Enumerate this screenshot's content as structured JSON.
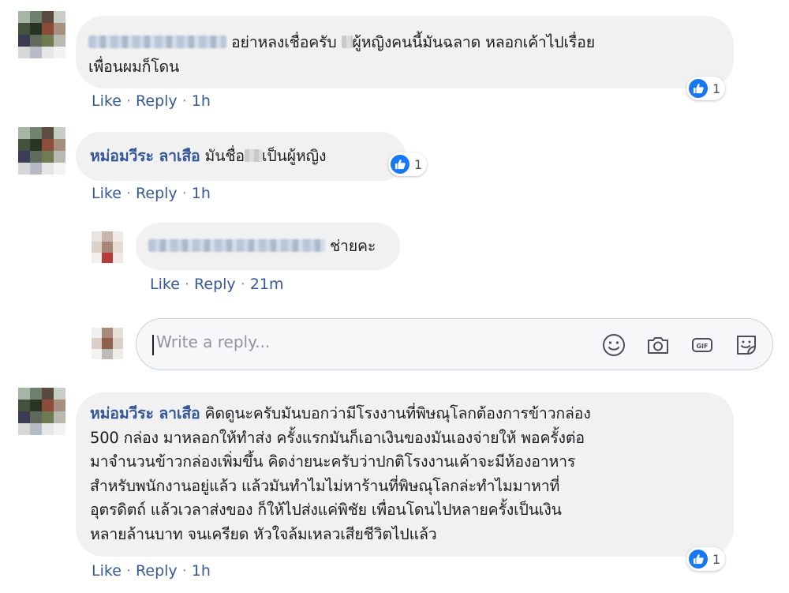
{
  "comments": [
    {
      "author": "",
      "text_line1": "อย่าหลงเชื่อครับ",
      "text_line1b": "ผู้หญิงคนนี้มันฉลาด หลอกเค้าไปเรื่อย",
      "text_line2": "เพื่อนผมก็โดน",
      "actions": {
        "like": "Like",
        "reply": "Reply",
        "time": "1h"
      },
      "reactions": {
        "count": "1"
      }
    },
    {
      "author": "หม่อมวีระ ลาเสือ",
      "text_a": "มันชื่อ",
      "text_b": "เป็นผู้หญิง",
      "actions": {
        "like": "Like",
        "reply": "Reply",
        "time": "1h"
      },
      "reactions": {
        "count": "1"
      }
    },
    {
      "author": "",
      "text": "ช่ายคะ",
      "actions": {
        "like": "Like",
        "reply": "Reply",
        "time": "21m"
      }
    },
    {
      "author": "หม่อมวีระ ลาเสือ",
      "lines": [
        "คิดดูนะครับมันบอกว่ามีโรงงานที่พิษณุโลกต้องการข้าวกล่อง",
        "500 กล่อง มาหลอกให้ทำส่ง ครั้งแรกมันก็เอาเงินของมันเองจ่ายให้ พอครั้งต่อ",
        "มาจำนวนข้าวกล่องเพิ่มขึ้น คิดง่ายนะครับว่าปกติโรงงานเค้าจะมีห้องอาหาร",
        "สำหรับพนักงานอยู่แล้ว แล้วมันทำไมไม่หาร้านที่พิษณุโลกล่ะทำไมมาหาที่",
        "อุตรดิตถ์ แล้วเวลาส่งของ ก็ให้ไปส่งแค่พิชัย เพื่อนโดนไปหลายครั้งเป็นเงิน",
        "หลายล้านบาท จนเครียด หัวใจล้มเหลวเสียชีวิตไปแล้ว"
      ],
      "actions": {
        "like": "Like",
        "reply": "Reply",
        "time": "1h"
      },
      "reactions": {
        "count": "1"
      }
    }
  ],
  "reply_box": {
    "placeholder": "Write a reply..."
  },
  "icons": [
    "emoji-icon",
    "camera-icon",
    "gif-icon",
    "sticker-icon",
    "like-reaction-icon"
  ],
  "colors": {
    "author": "#365899",
    "bubble": "#f1f1f1",
    "like": "#1877f2",
    "meta": "#385898"
  }
}
